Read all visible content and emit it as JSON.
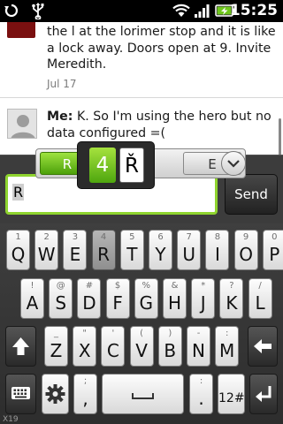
{
  "status_bar": {
    "time": "15:25",
    "icons": [
      "sync-icon",
      "usb-icon",
      "wifi-icon",
      "signal-icon",
      "battery-charging-icon"
    ]
  },
  "thread": {
    "messages": [
      {
        "text": "the l at the lorimer stop and it is like a lock away. Doors open at 9. Invite Meredith.",
        "date": "Jul 17"
      },
      {
        "sender": "Me:",
        "text": "K. So I'm using the hero but no data configured =("
      }
    ]
  },
  "compose": {
    "value": "R",
    "send_label": "Send"
  },
  "suggestions": {
    "items": [
      "R",
      "E"
    ],
    "popup": [
      "4",
      "Ř"
    ]
  },
  "keyboard": {
    "rows": [
      [
        {
          "main": "Q",
          "sub": "1"
        },
        {
          "main": "W",
          "sub": "2"
        },
        {
          "main": "E",
          "sub": "3"
        },
        {
          "main": "R",
          "sub": "4"
        },
        {
          "main": "T",
          "sub": "5"
        },
        {
          "main": "Y",
          "sub": "6"
        },
        {
          "main": "U",
          "sub": "7"
        },
        {
          "main": "I",
          "sub": "8"
        },
        {
          "main": "O",
          "sub": "9"
        },
        {
          "main": "P",
          "sub": "0"
        }
      ],
      [
        {
          "main": "A",
          "sub": "!"
        },
        {
          "main": "S",
          "sub": "@"
        },
        {
          "main": "D",
          "sub": "#"
        },
        {
          "main": "F",
          "sub": "$"
        },
        {
          "main": "G",
          "sub": "%"
        },
        {
          "main": "H",
          "sub": "&"
        },
        {
          "main": "J",
          "sub": "*"
        },
        {
          "main": "K",
          "sub": "?"
        },
        {
          "main": "L",
          "sub": "/"
        }
      ],
      [
        {
          "main": "Z",
          "sub": "_"
        },
        {
          "main": "X",
          "sub": "\""
        },
        {
          "main": "C",
          "sub": "'"
        },
        {
          "main": "V",
          "sub": "("
        },
        {
          "main": "B",
          "sub": ")"
        },
        {
          "main": "N",
          "sub": "-"
        },
        {
          "main": "M",
          "sub": ":"
        }
      ]
    ],
    "bottom": {
      "comma": ",",
      "comma_sub": ";",
      "period": ".",
      "period_sub": ":",
      "sym": "12#"
    },
    "corner_label": "X19"
  }
}
